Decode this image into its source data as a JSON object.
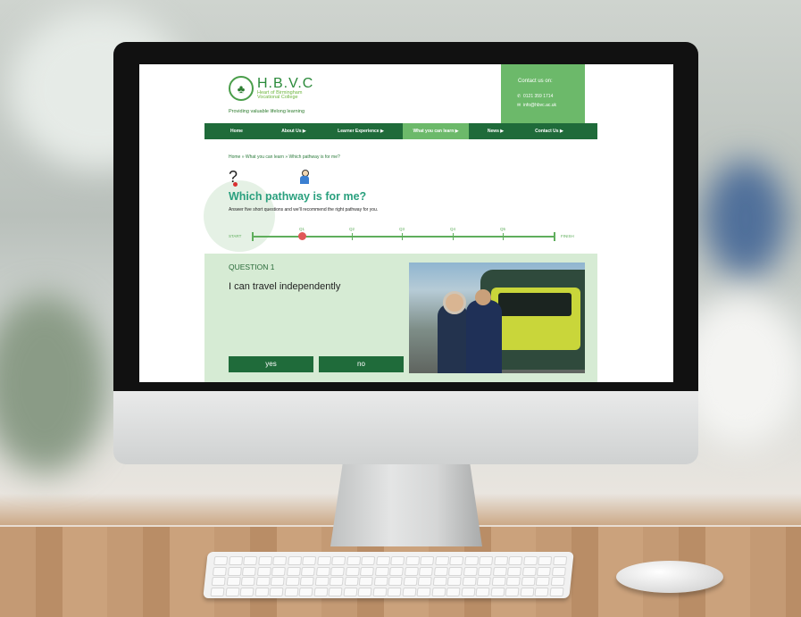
{
  "site": {
    "logo_title": "H.B.V.C",
    "logo_line1": "Heart of Birmingham",
    "logo_line2": "Vocational College",
    "tagline": "Providing valuable lifelong learning"
  },
  "contact": {
    "title": "Contact us on:",
    "phone": "0121 359 1714",
    "email": "info@hbvc.ac.uk"
  },
  "nav": {
    "items": [
      {
        "label": "Home"
      },
      {
        "label": "About Us ▶"
      },
      {
        "label": "Learner Experience ▶"
      },
      {
        "label": "What you can learn ▶"
      },
      {
        "label": "News ▶"
      },
      {
        "label": "Contact Us ▶"
      }
    ],
    "active_index": 3
  },
  "breadcrumb": {
    "text": "Home » What you can learn » Which pathway is for me?"
  },
  "page": {
    "title": "Which pathway is for me?",
    "subtitle": "Answer five short questions and we'll recommend the right pathway for you."
  },
  "progress": {
    "start_label": "START",
    "finish_label": "FINISH",
    "steps": [
      "Q1",
      "Q2",
      "Q3",
      "Q4",
      "Q5"
    ],
    "current": 1
  },
  "question": {
    "number_label": "QUESTION 1",
    "text": "I can travel independently",
    "yes_label": "yes",
    "no_label": "no"
  },
  "icons": {
    "question": "question-mark-icon",
    "person": "person-icon",
    "phone": "phone-icon",
    "email": "email-icon"
  },
  "colors": {
    "nav_green": "#1f6b3a",
    "accent_green": "#6cb96a",
    "title_teal": "#2aa07e",
    "panel_bg": "#d6ebd4",
    "progress_dot": "#e05858"
  }
}
